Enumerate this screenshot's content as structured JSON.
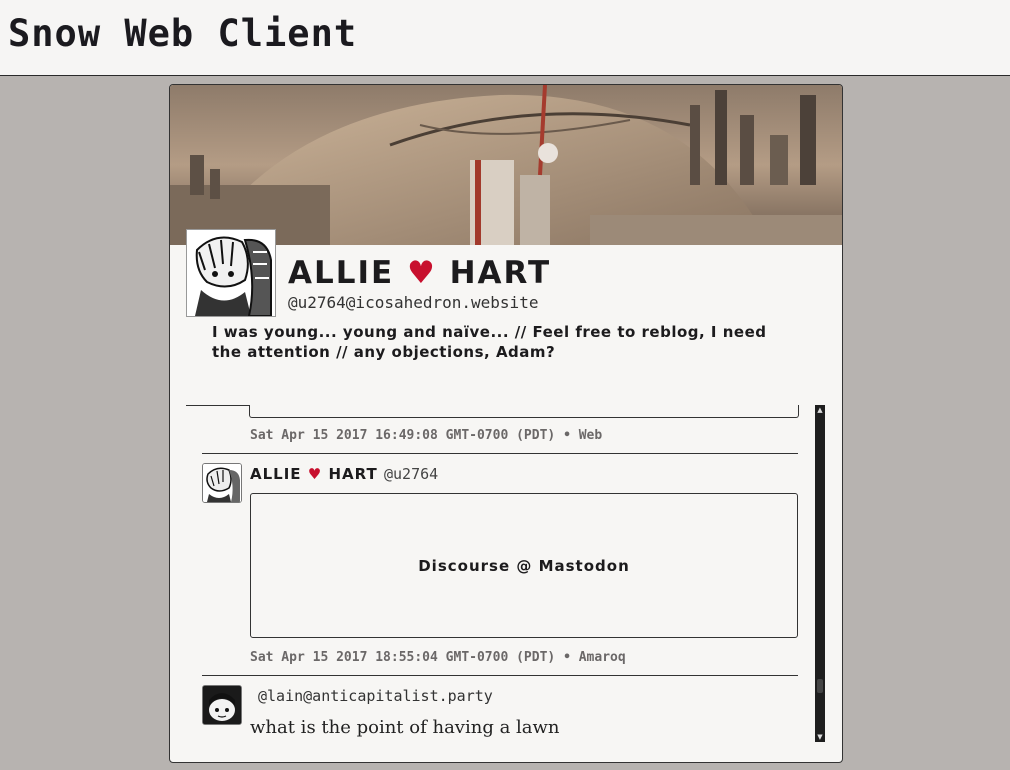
{
  "app": {
    "title": "Snow Web Client"
  },
  "profile": {
    "name_left": "ALLIE",
    "name_heart": "♥",
    "name_right": "HART",
    "handle": "@u2764@icosahedron.website",
    "bio": "I was young... young and naïve... // Feel free to reblog, I need the attention // any objections, Adam?"
  },
  "timeline": {
    "posts": [
      {
        "meta": "Sat Apr 15 2017 16:49:08 GMT-0700 (PDT) • Web"
      },
      {
        "name_left": "ALLIE",
        "name_heart": "♥",
        "name_right": "HART",
        "handle": "@u2764",
        "card_title": "Discourse @ Mastodon",
        "meta": "Sat Apr 15 2017 18:55:04 GMT-0700 (PDT) • Amaroq"
      },
      {
        "handle": "@lain@anticapitalist.party",
        "text": "what is the point of having a lawn"
      }
    ]
  },
  "scrollbar": {
    "up_icon": "▲",
    "down_icon": "▼"
  },
  "colors": {
    "accent": "#c8102e",
    "background": "#b7b3b0",
    "card": "#f7f6f4"
  }
}
